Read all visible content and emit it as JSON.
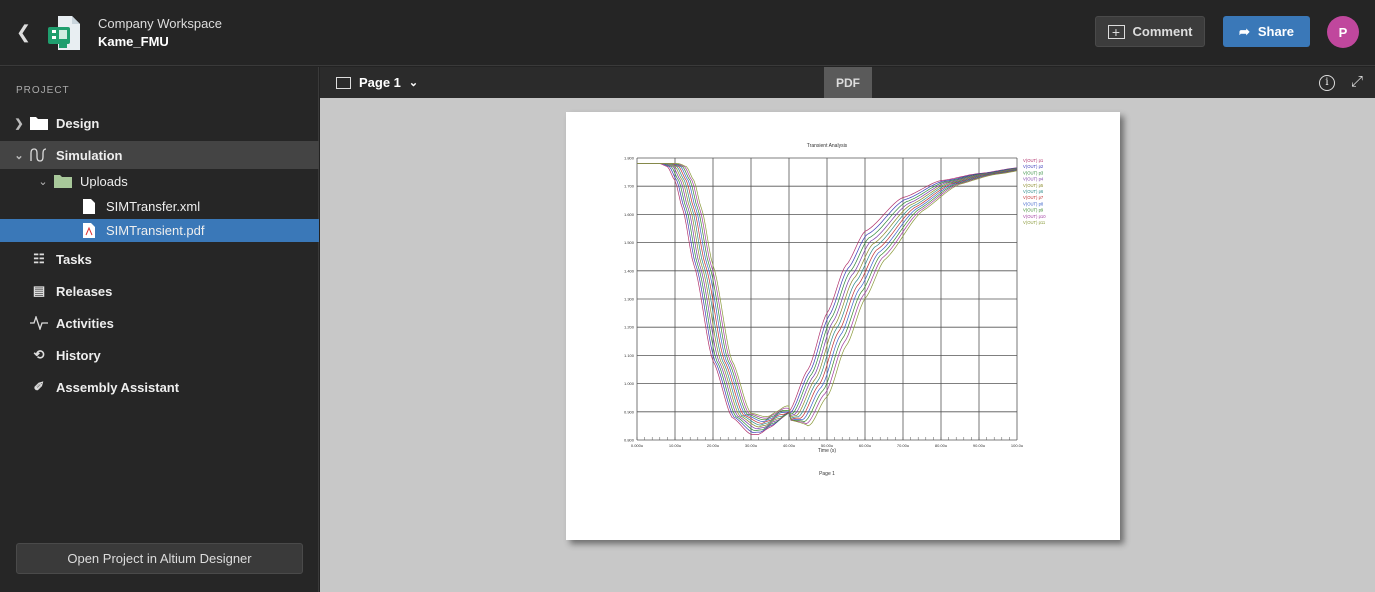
{
  "header": {
    "workspace": "Company Workspace",
    "project": "Kame_FMU",
    "comment": "Comment",
    "share": "Share",
    "avatar": "P"
  },
  "sidebar": {
    "section": "PROJECT",
    "items": [
      {
        "label": "Design",
        "icon": "folder-icon"
      },
      {
        "label": "Simulation",
        "icon": "simulation-icon"
      },
      {
        "label": "Uploads",
        "icon": "folder-icon"
      },
      {
        "label": "SIMTransfer.xml",
        "icon": "file-icon"
      },
      {
        "label": "SIMTransient.pdf",
        "icon": "pdf-file-icon"
      },
      {
        "label": "Tasks",
        "icon": "tasks-icon"
      },
      {
        "label": "Releases",
        "icon": "releases-icon"
      },
      {
        "label": "Activities",
        "icon": "activity-icon"
      },
      {
        "label": "History",
        "icon": "history-icon"
      },
      {
        "label": "Assembly Assistant",
        "icon": "assembly-icon"
      }
    ],
    "open_button": "Open Project in Altium Designer"
  },
  "toolbar": {
    "page": "Page 1",
    "tab": "PDF"
  },
  "pdf": {
    "footer": "Page 1"
  },
  "chart_data": {
    "type": "line",
    "title": "Transient Analysis",
    "xlabel": "Time (s)",
    "ylabel": "",
    "xlim": [
      0,
      100
    ],
    "ylim": [
      0.8,
      1.8
    ],
    "grid": true,
    "legend": "right",
    "xticks": [
      "0.000u",
      "10.00u",
      "20.00u",
      "30.00u",
      "40.00u",
      "50.00u",
      "60.00u",
      "70.00u",
      "80.00u",
      "90.00u",
      "100.0u"
    ],
    "yticks": [
      "0.800",
      "0.900",
      "1.000",
      "1.100",
      "1.200",
      "1.300",
      "1.400",
      "1.500",
      "1.600",
      "1.700",
      "1.800"
    ],
    "base_x": [
      0,
      6,
      8,
      10,
      12,
      15,
      20,
      25,
      30,
      32,
      35,
      40,
      45,
      50,
      55,
      60,
      70,
      80,
      90,
      100
    ],
    "base_y": [
      1.78,
      1.78,
      1.77,
      1.72,
      1.62,
      1.42,
      1.08,
      0.88,
      0.82,
      0.82,
      0.845,
      0.9,
      1.05,
      1.25,
      1.42,
      1.54,
      1.66,
      1.72,
      1.745,
      1.765
    ],
    "series": [
      {
        "name": "V(OUT) p1",
        "color": "#b0306a",
        "x_shift": 0,
        "min_lift": 0
      },
      {
        "name": "V(OUT) p2",
        "color": "#3a3ab8",
        "x_shift": 0.5,
        "min_lift": 0.006
      },
      {
        "name": "V(OUT) p3",
        "color": "#2e8a3a",
        "x_shift": 1.0,
        "min_lift": 0.012
      },
      {
        "name": "V(OUT) p4",
        "color": "#7a3aa8",
        "x_shift": 1.5,
        "min_lift": 0.018
      },
      {
        "name": "V(OUT) p5",
        "color": "#8a8a2a",
        "x_shift": 2.0,
        "min_lift": 0.024
      },
      {
        "name": "V(OUT) p6",
        "color": "#2a8a8a",
        "x_shift": 2.5,
        "min_lift": 0.03
      },
      {
        "name": "V(OUT) p7",
        "color": "#c03030",
        "x_shift": 3.0,
        "min_lift": 0.036
      },
      {
        "name": "V(OUT) p8",
        "color": "#3a60c8",
        "x_shift": 3.5,
        "min_lift": 0.042
      },
      {
        "name": "V(OUT) p9",
        "color": "#3a8a2a",
        "x_shift": 4.0,
        "min_lift": 0.048
      },
      {
        "name": "V(OUT) p10",
        "color": "#a03aa0",
        "x_shift": 4.5,
        "min_lift": 0.054
      },
      {
        "name": "V(OUT) p11",
        "color": "#8a9a3a",
        "x_shift": 5.0,
        "min_lift": 0.06
      }
    ]
  },
  "colors": {
    "accent": "#3a78b8",
    "selected": "#3a78b8",
    "avatar": "#c0479d"
  }
}
